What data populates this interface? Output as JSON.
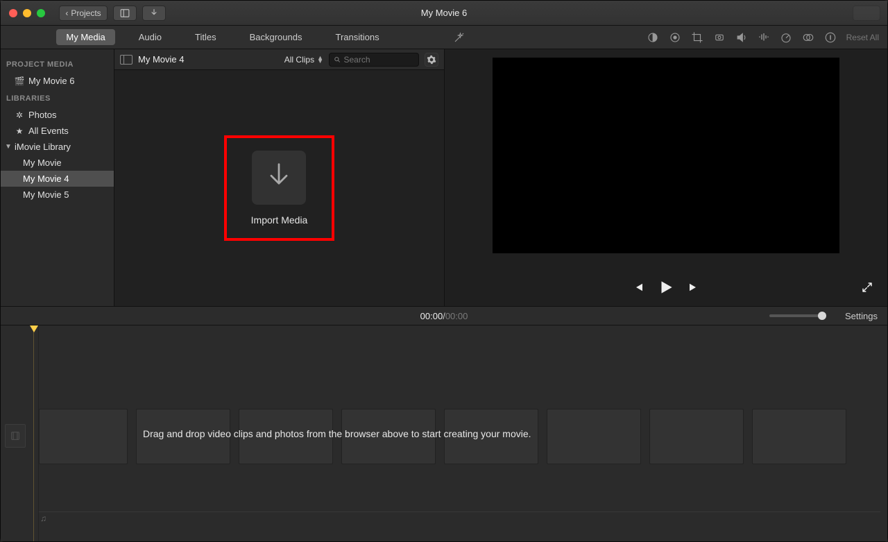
{
  "titlebar": {
    "title": "My Movie 6",
    "back_label": "Projects"
  },
  "tabs": {
    "my_media": "My Media",
    "audio": "Audio",
    "titles": "Titles",
    "backgrounds": "Backgrounds",
    "transitions": "Transitions"
  },
  "adjust": {
    "reset_all": "Reset All"
  },
  "sidebar": {
    "project_media_header": "PROJECT MEDIA",
    "project_name": "My Movie 6",
    "libraries_header": "LIBRARIES",
    "photos": "Photos",
    "all_events": "All Events",
    "imovie_library": "iMovie Library",
    "events": [
      "My Movie",
      "My Movie 4",
      "My Movie 5"
    ],
    "selected_event": "My Movie 4"
  },
  "browser": {
    "title": "My Movie 4",
    "filter_label": "All Clips",
    "search_placeholder": "Search",
    "import_label": "Import Media"
  },
  "timecode": {
    "current": "00:00",
    "separator": " / ",
    "duration": "00:00",
    "settings": "Settings"
  },
  "timeline": {
    "hint": "Drag and drop video clips and photos from the browser above to start creating your movie."
  }
}
